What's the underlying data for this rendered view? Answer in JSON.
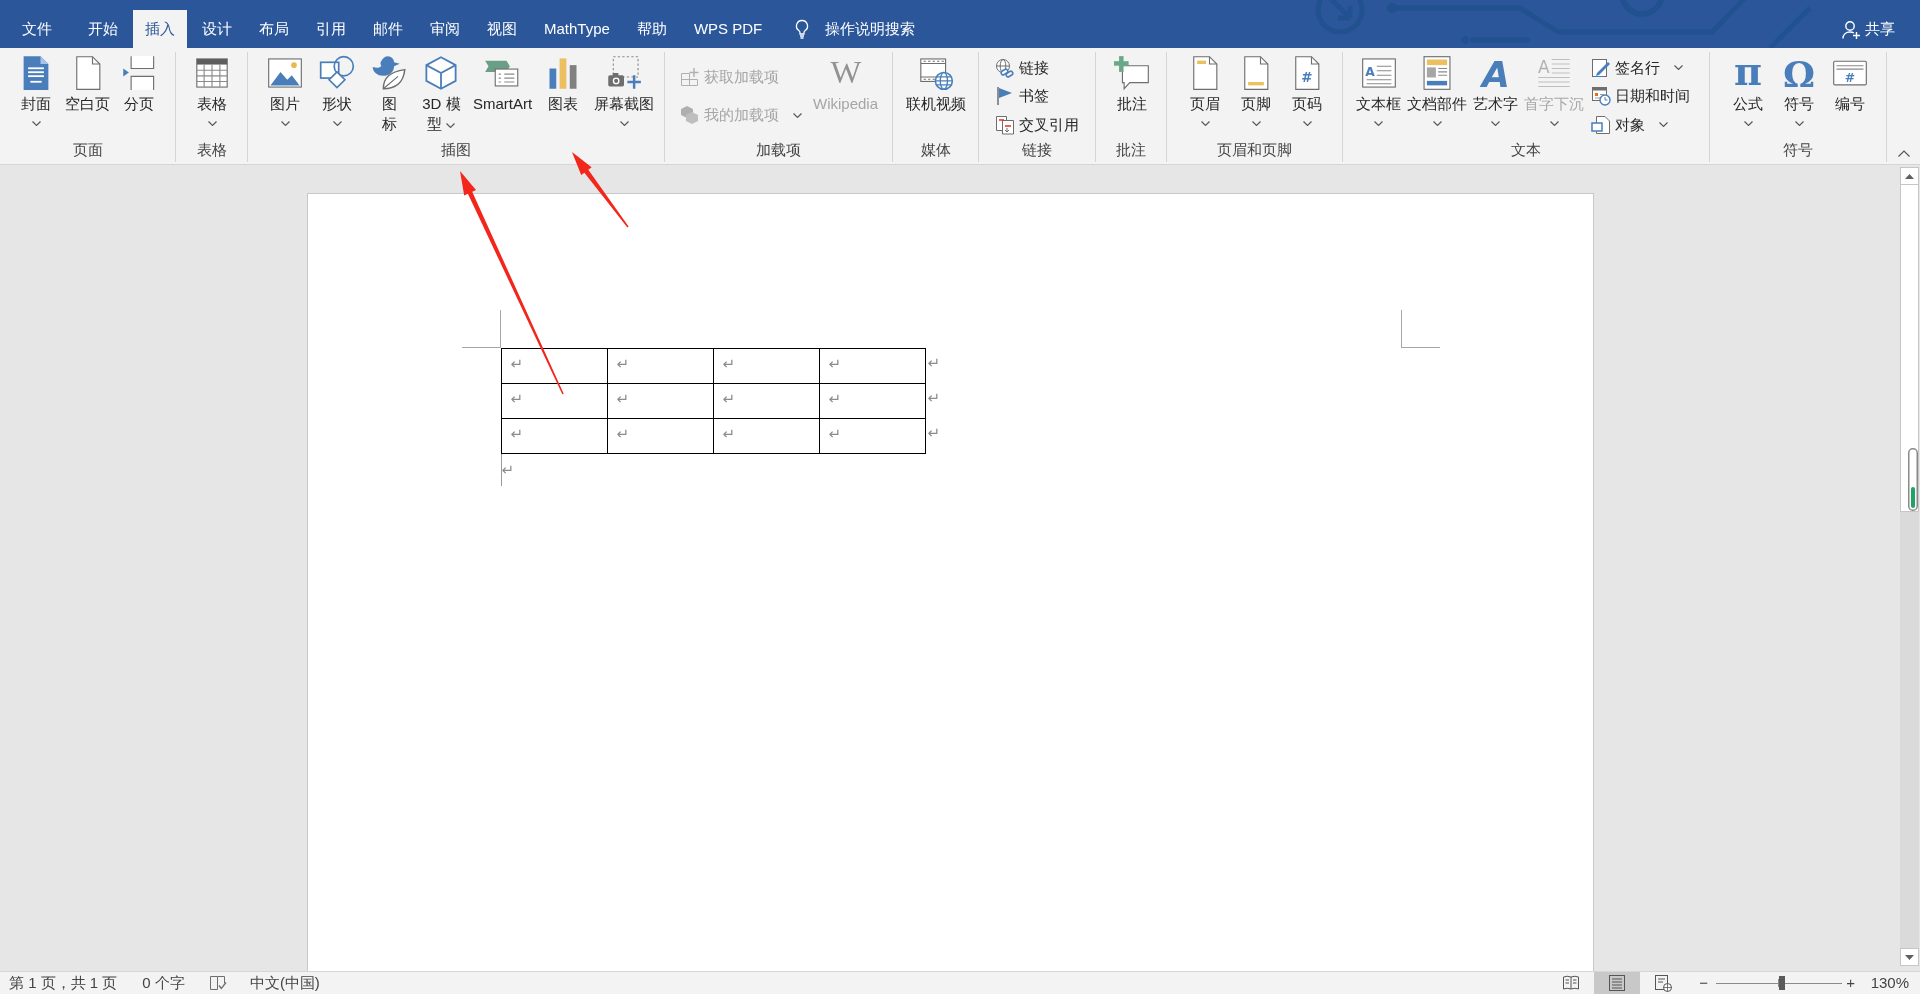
{
  "title_bar": {
    "tabs": [
      {
        "label": "文件",
        "selected": false
      },
      {
        "label": "开始",
        "selected": false
      },
      {
        "label": "插入",
        "selected": true
      },
      {
        "label": "设计",
        "selected": false
      },
      {
        "label": "布局",
        "selected": false
      },
      {
        "label": "引用",
        "selected": false
      },
      {
        "label": "邮件",
        "selected": false
      },
      {
        "label": "审阅",
        "selected": false
      },
      {
        "label": "视图",
        "selected": false
      },
      {
        "label": "MathType",
        "selected": false
      },
      {
        "label": "帮助",
        "selected": false
      },
      {
        "label": "WPS PDF",
        "selected": false
      }
    ],
    "tell_me": {
      "label": "操作说明搜索"
    },
    "share": {
      "label": "共享"
    }
  },
  "ribbon": {
    "groups": [
      {
        "label": "页面",
        "items": [
          {
            "kind": "large",
            "label": "封面",
            "dropdown": true,
            "disabled": false
          },
          {
            "kind": "large",
            "label": "空白页",
            "dropdown": false,
            "disabled": false
          },
          {
            "kind": "large",
            "label": "分页",
            "dropdown": false,
            "disabled": false
          }
        ]
      },
      {
        "label": "表格",
        "items": [
          {
            "kind": "large",
            "label": "表格",
            "dropdown": true,
            "disabled": false
          }
        ]
      },
      {
        "label": "插图",
        "items": [
          {
            "kind": "large",
            "label": "图片",
            "dropdown": true,
            "disabled": false
          },
          {
            "kind": "large",
            "label": "形状",
            "dropdown": true,
            "disabled": false
          },
          {
            "kind": "large",
            "label": "图标",
            "dropdown": false,
            "disabled": false
          },
          {
            "kind": "large",
            "label": "3D 模型",
            "dropdown": true,
            "disabled": false
          },
          {
            "kind": "large",
            "label": "SmartArt",
            "dropdown": false,
            "disabled": false
          },
          {
            "kind": "large",
            "label": "图表",
            "dropdown": false,
            "disabled": false
          },
          {
            "kind": "large",
            "label": "屏幕截图",
            "dropdown": true,
            "disabled": false
          }
        ]
      },
      {
        "label": "加载项",
        "items": [
          {
            "kind": "small",
            "label": "获取加载项",
            "dropdown": false,
            "disabled": true
          },
          {
            "kind": "small",
            "label": "我的加载项",
            "dropdown": true,
            "disabled": true
          },
          {
            "kind": "large",
            "label": "Wikipedia",
            "icon_glyph": "W",
            "dropdown": false,
            "disabled": true
          }
        ]
      },
      {
        "label": "媒体",
        "items": [
          {
            "kind": "large",
            "label": "联机视频",
            "dropdown": false,
            "disabled": false
          }
        ]
      },
      {
        "label": "链接",
        "items": [
          {
            "kind": "small",
            "label": "链接",
            "dropdown": false,
            "disabled": false
          },
          {
            "kind": "small",
            "label": "书签",
            "dropdown": false,
            "disabled": false
          },
          {
            "kind": "small",
            "label": "交叉引用",
            "dropdown": false,
            "disabled": false
          }
        ]
      },
      {
        "label": "批注",
        "items": [
          {
            "kind": "large",
            "label": "批注",
            "dropdown": false,
            "disabled": false
          }
        ]
      },
      {
        "label": "页眉和页脚",
        "items": [
          {
            "kind": "large",
            "label": "页眉",
            "dropdown": true,
            "disabled": false
          },
          {
            "kind": "large",
            "label": "页脚",
            "dropdown": true,
            "disabled": false
          },
          {
            "kind": "large",
            "label": "页码",
            "icon_glyph": "#",
            "dropdown": true,
            "disabled": false
          }
        ]
      },
      {
        "label": "文本",
        "items": [
          {
            "kind": "large",
            "label": "文本框",
            "icon_glyph": "A",
            "dropdown": true,
            "disabled": false
          },
          {
            "kind": "large",
            "label": "文档部件",
            "dropdown": true,
            "disabled": false
          },
          {
            "kind": "large",
            "label": "艺术字",
            "icon_glyph": "A",
            "dropdown": true,
            "disabled": false
          },
          {
            "kind": "large",
            "label": "首字下沉",
            "icon_glyph": "A",
            "dropdown": true,
            "disabled": true
          },
          {
            "kind": "small",
            "label": "签名行",
            "dropdown": true,
            "disabled": false
          },
          {
            "kind": "small",
            "label": "日期和时间",
            "dropdown": false,
            "disabled": false
          },
          {
            "kind": "small",
            "label": "对象",
            "dropdown": true,
            "disabled": false
          }
        ]
      },
      {
        "label": "符号",
        "items": [
          {
            "kind": "large",
            "label": "公式",
            "icon_glyph": "π",
            "dropdown": true,
            "disabled": false
          },
          {
            "kind": "large",
            "label": "符号",
            "icon_glyph": "Ω",
            "dropdown": true,
            "disabled": false
          },
          {
            "kind": "large",
            "label": "编号",
            "icon_glyph": "#",
            "dropdown": false,
            "disabled": false
          }
        ]
      }
    ]
  },
  "document": {
    "table": {
      "rows": [
        [
          "↵",
          "↵",
          "↵",
          "↵"
        ],
        [
          "↵",
          "↵",
          "↵",
          "↵"
        ],
        [
          "↵",
          "↵",
          "↵",
          "↵"
        ]
      ],
      "row_end_marks": [
        "↵",
        "↵",
        "↵"
      ]
    },
    "paragraph_mark": "↵"
  },
  "annotations": [
    {
      "kind": "arrow"
    },
    {
      "kind": "arrow"
    }
  ],
  "status_bar": {
    "page_info": "第 1 页，共 1 页",
    "word_count": "0 个字",
    "language": "中文(中国)",
    "views": [
      {
        "selected": false
      },
      {
        "selected": true
      },
      {
        "selected": false
      }
    ],
    "zoom_out": "−",
    "zoom_in": "+",
    "zoom": {
      "level": 0.53,
      "reading": "130%"
    }
  }
}
